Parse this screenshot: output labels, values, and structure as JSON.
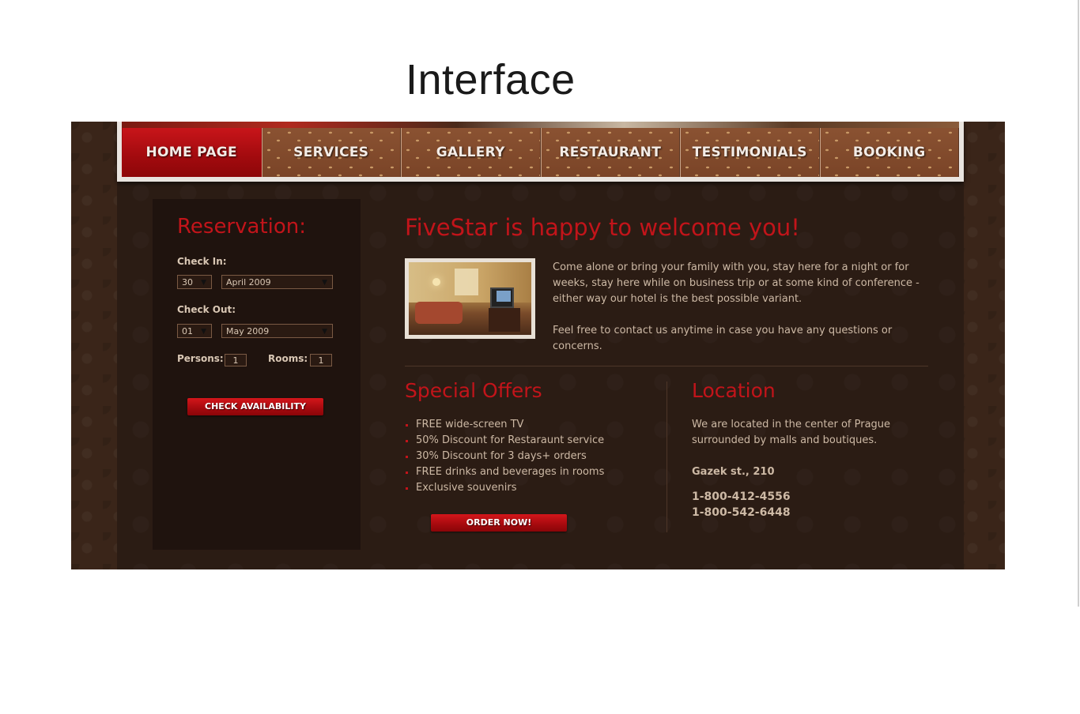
{
  "slide": {
    "title": "Interface"
  },
  "nav": {
    "items": [
      "HOME PAGE",
      "SERVICES",
      "GALLERY",
      "RESTAURANT",
      "TESTIMONIALS",
      "BOOKING"
    ],
    "active": "HOME PAGE"
  },
  "reservation": {
    "title": "Reservation:",
    "check_in_label": "Check In:",
    "check_in_day": "30",
    "check_in_month": "April 2009",
    "check_out_label": "Check Out:",
    "check_out_day": "01",
    "check_out_month": "May 2009",
    "persons_label": "Persons:",
    "persons_value": "1",
    "rooms_label": "Rooms:",
    "rooms_value": "1",
    "button": "CHECK AVAILABILITY"
  },
  "welcome": {
    "title": "FiveStar is happy to welcome you!",
    "para1": "Come alone or bring your family with you, stay here for a night or for weeks, stay here while on business trip or at some kind of conference - either way our hotel is the best possible variant.",
    "para2": "Feel free to contact us anytime in case you have any questions or concerns."
  },
  "offers": {
    "title": "Special Offers",
    "items": [
      "FREE wide-screen TV",
      "50% Discount for Restaraunt service",
      "30% Discount for 3 days+ orders",
      "FREE drinks and beverages in rooms",
      "Exclusive souvenirs"
    ],
    "button": "ORDER NOW!"
  },
  "location": {
    "title": "Location",
    "text": "We are located in the center of Prague surrounded by malls and boutiques.",
    "address": "Gazek st., 210",
    "phone1": "1-800-412-4556",
    "phone2": "1-800-542-6448"
  },
  "colors": {
    "accent_red": "#c2141a",
    "page_bg": "#2b1c14",
    "text": "#cdb9a5"
  }
}
